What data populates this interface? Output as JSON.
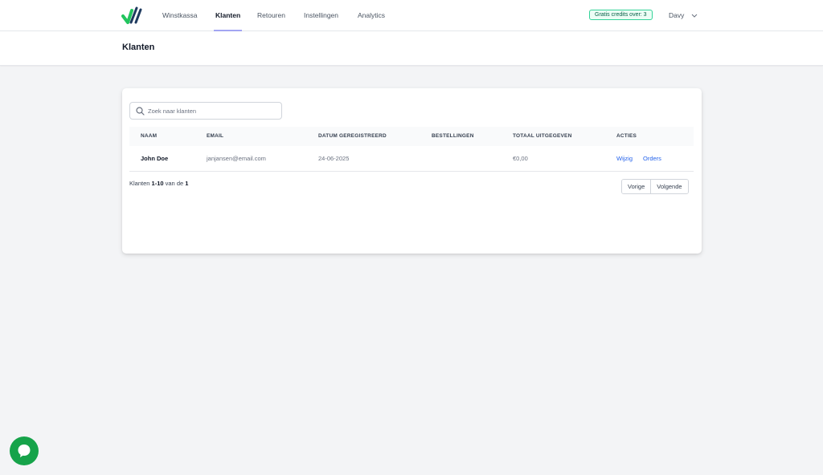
{
  "nav": {
    "items": [
      {
        "label": "Winstkassa"
      },
      {
        "label": "Klanten"
      },
      {
        "label": "Retouren"
      },
      {
        "label": "Instellingen"
      },
      {
        "label": "Analytics"
      }
    ],
    "active_index": 1,
    "credits_badge": "Gratis credits over: 3",
    "user_name": "Davy",
    "logo_icon": "checkmark-logo-icon",
    "colors": {
      "accent": "#6366f1",
      "logo_green": "#22c55e",
      "logo_navy": "#1e3a5f",
      "badge_green": "#34d399"
    }
  },
  "page": {
    "title": "Klanten"
  },
  "search": {
    "placeholder": "Zoek naar klanten",
    "value": "",
    "icon": "search-icon"
  },
  "table": {
    "columns": [
      "NAAM",
      "EMAIL",
      "DATUM GEREGISTREERD",
      "BESTELLINGEN",
      "TOTAAL UITGEGEVEN",
      "ACTIES"
    ],
    "rows": [
      {
        "name": "John Doe",
        "email": "janjansen@email.com",
        "registered": "24-06-2025",
        "orders_count": "",
        "total_spent": "€0,00",
        "actions": [
          "Wijzig",
          "Orders"
        ]
      }
    ],
    "link_color": "#2563eb"
  },
  "pagination": {
    "prefix": "Klanten",
    "range": "1-10",
    "middle": "van de",
    "total": "1",
    "prev_label": "Vorige",
    "next_label": "Volgende"
  },
  "chat": {
    "icon": "chat-bubble-icon",
    "color": "#16a34a"
  }
}
